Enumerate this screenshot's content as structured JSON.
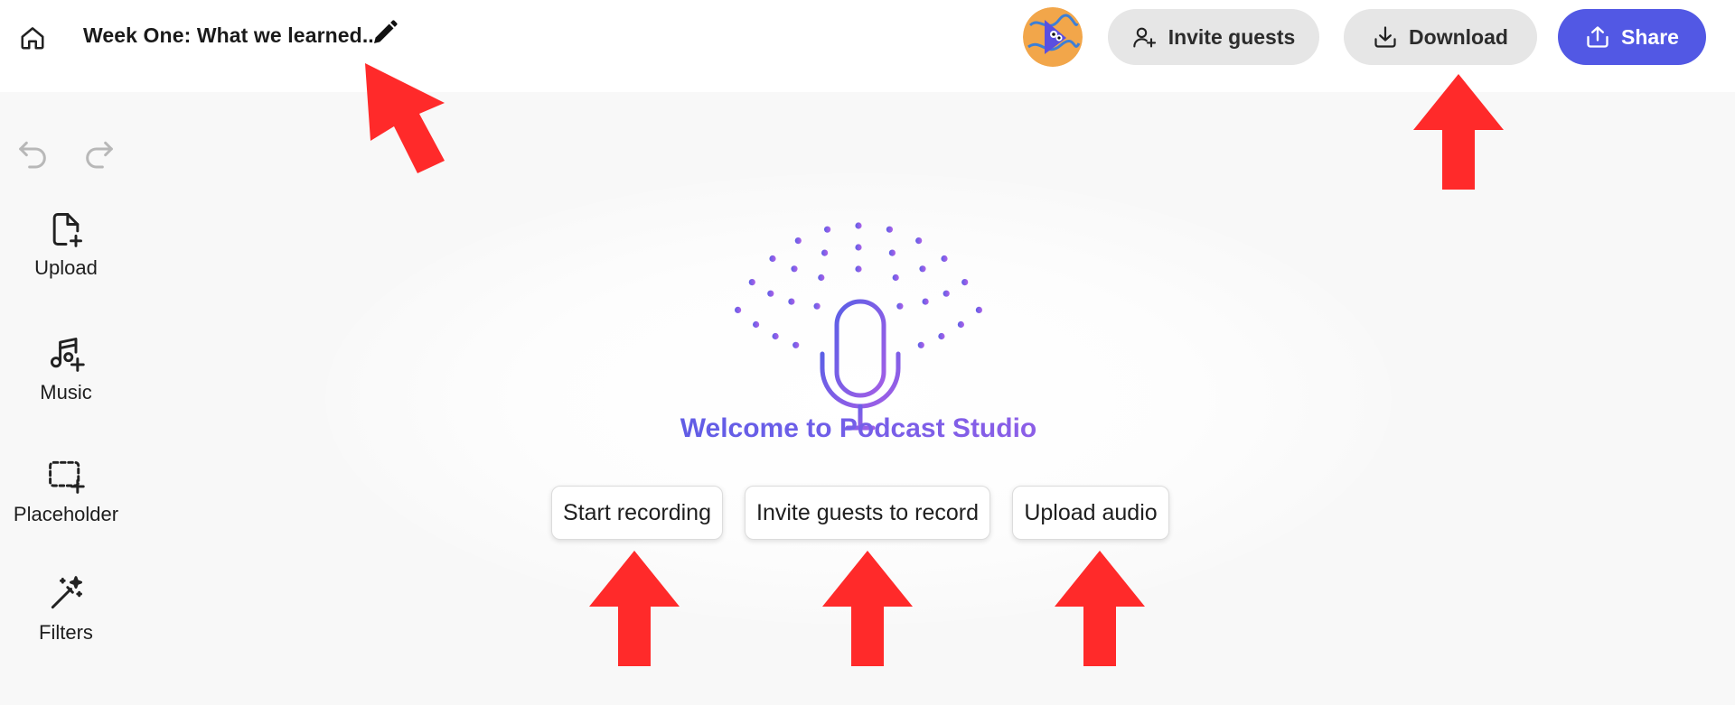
{
  "header": {
    "document_title": "Week One: What we learned...",
    "invite_label": "Invite guests",
    "download_label": "Download",
    "share_label": "Share"
  },
  "sidebar": {
    "tools": [
      {
        "label": "Upload",
        "icon": "file-add-icon"
      },
      {
        "label": "Music",
        "icon": "music-add-icon"
      },
      {
        "label": "Placeholder",
        "icon": "placeholder-add-icon"
      },
      {
        "label": "Filters",
        "icon": "magic-wand-icon"
      }
    ]
  },
  "main": {
    "welcome_title": "Welcome to Podcast Studio",
    "actions": [
      {
        "label": "Start recording"
      },
      {
        "label": "Invite guests to record"
      },
      {
        "label": "Upload audio"
      }
    ]
  },
  "colors": {
    "accent_blue": "#5258e4",
    "gradient_start": "#4f5ae0",
    "gradient_end": "#a35ee6",
    "annotation_red": "#ff2a2a"
  }
}
